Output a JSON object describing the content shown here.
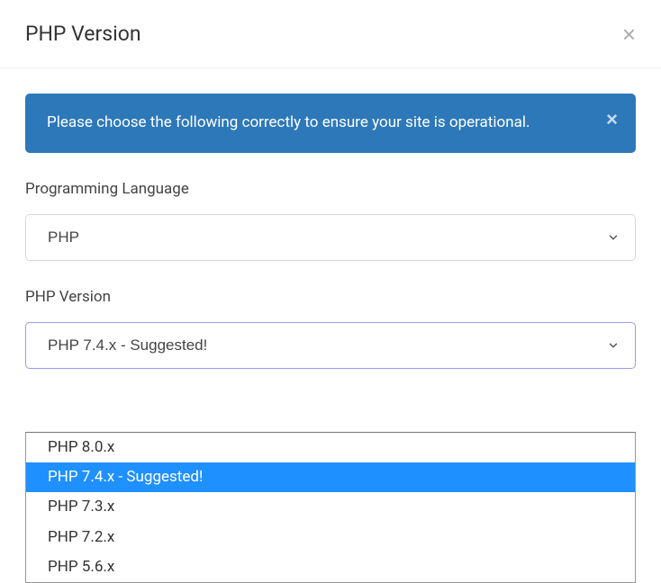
{
  "header": {
    "title": "PHP Version"
  },
  "alert": {
    "message": "Please choose the following correctly to ensure your site is operational."
  },
  "form": {
    "lang_label": "Programming Language",
    "lang_value": "PHP",
    "version_label": "PHP Version",
    "version_value": "PHP 7.4.x - Suggested!",
    "version_options": [
      "PHP 8.0.x",
      "PHP 7.4.x - Suggested!",
      "PHP 7.3.x",
      "PHP 7.2.x",
      "PHP 5.6.x"
    ],
    "version_selected_index": 1
  }
}
